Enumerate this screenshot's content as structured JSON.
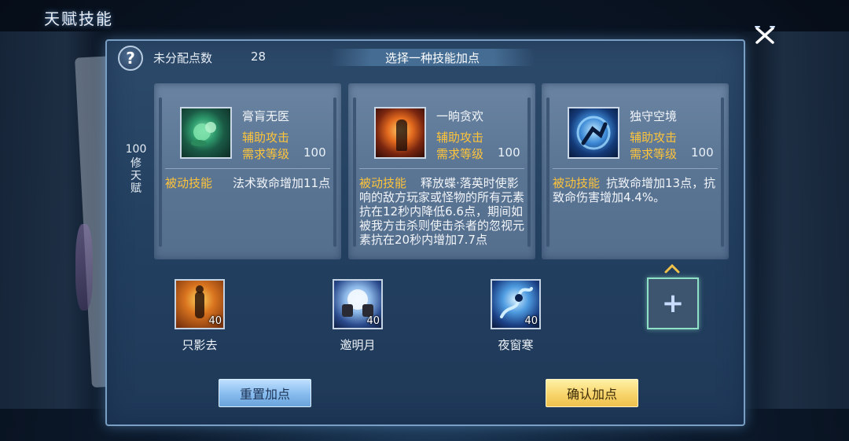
{
  "window": {
    "title": "天赋技能"
  },
  "header": {
    "help_icon_text": "?",
    "unassigned_points_label": "未分配点数",
    "unassigned_points_value": "28",
    "select_title": "选择一种技能加点"
  },
  "side": {
    "level": "100",
    "label": "修天赋"
  },
  "cards": [
    {
      "name": "膏肓无医",
      "line1": "辅助攻击",
      "line2": "需求等级",
      "req_level": "100",
      "desc_tag": "被动技能",
      "desc_text": "法术致命增加11点",
      "icon": "healing-gourd-icon"
    },
    {
      "name": "一晌贪欢",
      "line1": "辅助攻击",
      "line2": "需求等级",
      "req_level": "100",
      "desc_tag": "被动技能",
      "desc_text": "释放蝶·落英时使影响的敌方玩家或怪物的所有元素抗在12秒内降低6.6点，期间如被我方击杀则使击杀者的忽视元素抗在20秒内增加7.7点",
      "icon": "warrior-silhouette-icon"
    },
    {
      "name": "独守空境",
      "line1": "辅助攻击",
      "line2": "需求等级",
      "req_level": "100",
      "desc_tag": "被动技能",
      "desc_text": "抗致命增加13点，抗致命伤害增加4.4%。",
      "icon": "blue-swordsman-icon"
    }
  ],
  "slots": [
    {
      "label": "只影去",
      "level": "40",
      "icon": "lone-warrior-icon"
    },
    {
      "label": "邀明月",
      "level": "40",
      "icon": "moon-toast-icon"
    },
    {
      "label": "夜窗寒",
      "level": "40",
      "icon": "night-dancer-icon"
    }
  ],
  "add_slot": {
    "icon": "plus-icon",
    "symbol": "+"
  },
  "buttons": {
    "reset": "重置加点",
    "confirm": "确认加点"
  },
  "colors": {
    "accent_gold": "#ffc43a",
    "panel_border": "#7a9fc4",
    "reset_button": "#86bbee",
    "confirm_button": "#f7d56b",
    "add_slot_border": "#8ee0c6"
  }
}
